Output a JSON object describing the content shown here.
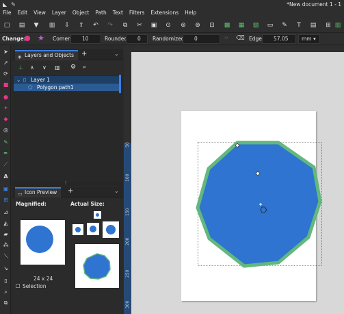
{
  "window": {
    "title": "*New document 1 - 1"
  },
  "menu": [
    "File",
    "Edit",
    "View",
    "Layer",
    "Object",
    "Path",
    "Text",
    "Filters",
    "Extensions",
    "Help"
  ],
  "tool_controls": {
    "change_label": "Change:",
    "corners_label": "Corners",
    "corners_value": "10",
    "rounded_label": "Rounded",
    "rounded_value": "0",
    "randomized_label": "Randomized",
    "randomized_value": "0",
    "edge_label": "Edge",
    "edge_value": "57.05",
    "unit": "mm"
  },
  "layers_panel": {
    "tab_label": "Layers and Objects",
    "add_tab": "+",
    "layer_name": "Layer 1",
    "object_name": "Polygon path1"
  },
  "icon_preview": {
    "tab_label": "Icon Preview",
    "add_tab": "+",
    "magnified_label": "Magnified:",
    "actual_size_label": "Actual Size:",
    "size_text": "24 x 24",
    "selection_label": "Selection"
  },
  "rulers": {
    "vertical": [
      "50",
      "100",
      "150",
      "200",
      "250",
      "300"
    ]
  },
  "colors": {
    "shape_fill": "#2e74d0",
    "shape_stroke": "#62b87e",
    "accent": "#3a80e0"
  }
}
